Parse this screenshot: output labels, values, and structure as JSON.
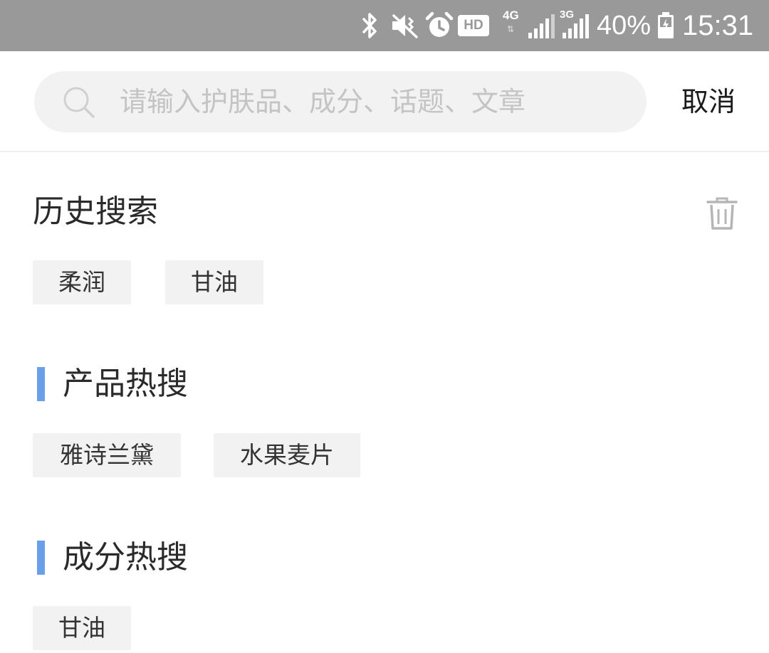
{
  "status_bar": {
    "icons": [
      "bluetooth-icon",
      "vibrate-icon",
      "alarm-icon",
      "hd-icon",
      "4g-signal-icon",
      "3g-signal-icon",
      "battery-charging-icon"
    ],
    "hd_label": "HD",
    "net_4g_label": "4G",
    "net_3g_label": "3G",
    "battery_percent": "40%",
    "time": "15:31",
    "background": "#999999"
  },
  "search": {
    "placeholder": "请输入护肤品、成分、话题、文章",
    "value": "",
    "cancel_label": "取消"
  },
  "history": {
    "title": "历史搜索",
    "clear_icon": "trash-icon",
    "tags": [
      "柔润",
      "甘油"
    ]
  },
  "hot_products": {
    "title": "产品热搜",
    "tags": [
      "雅诗兰黛",
      "水果麦片"
    ]
  },
  "hot_ingredients": {
    "title": "成分热搜",
    "tags": [
      "甘油"
    ]
  },
  "colors": {
    "accent": "#6aa0ea",
    "tag_background": "#f2f2f2",
    "search_background": "#f2f2f2"
  }
}
